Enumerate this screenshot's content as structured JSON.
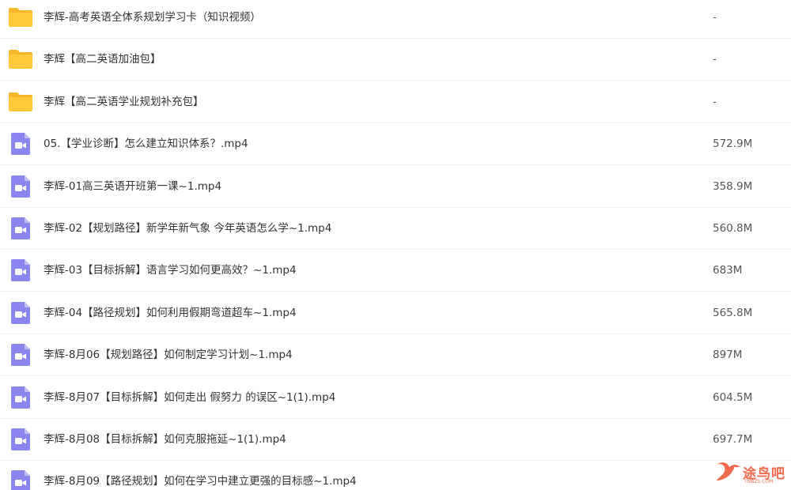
{
  "colors": {
    "folder": "#ffc93c",
    "folder_tab": "#f6b72a",
    "video": "#8b85f0",
    "watermark": "#f06a4b"
  },
  "files": [
    {
      "name": "李辉-高考英语全体系规划学习卡（知识视频）",
      "size": "-",
      "type": "folder",
      "icon": "folder-icon"
    },
    {
      "name": "李辉【高二英语加油包】",
      "size": "-",
      "type": "folder",
      "icon": "folder-icon"
    },
    {
      "name": "李辉【高二英语学业规划补充包】",
      "size": "-",
      "type": "folder",
      "icon": "folder-icon"
    },
    {
      "name": "05.【学业诊断】怎么建立知识体系？.mp4",
      "size": "572.9M",
      "type": "video",
      "icon": "video-file-icon"
    },
    {
      "name": "李辉-01高三英语开班第一课~1.mp4",
      "size": "358.9M",
      "type": "video",
      "icon": "video-file-icon"
    },
    {
      "name": "李辉-02【规划路径】新学年新气象 今年英语怎么学~1.mp4",
      "size": "560.8M",
      "type": "video",
      "icon": "video-file-icon"
    },
    {
      "name": "李辉-03【目标拆解】语言学习如何更高效？~1.mp4",
      "size": "683M",
      "type": "video",
      "icon": "video-file-icon"
    },
    {
      "name": "李辉-04【路径规划】如何利用假期弯道超车~1.mp4",
      "size": "565.8M",
      "type": "video",
      "icon": "video-file-icon"
    },
    {
      "name": "李辉-8月06【规划路径】如何制定学习计划~1.mp4",
      "size": "897M",
      "type": "video",
      "icon": "video-file-icon"
    },
    {
      "name": "李辉-8月07【目标拆解】如何走出 假努力 的误区~1(1).mp4",
      "size": "604.5M",
      "type": "video",
      "icon": "video-file-icon"
    },
    {
      "name": "李辉-8月08【目标拆解】如何克服拖延~1(1).mp4",
      "size": "697.7M",
      "type": "video",
      "icon": "video-file-icon"
    },
    {
      "name": "李辉-8月09【路径规划】如何在学习中建立更强的目标感~1.mp4",
      "size": "",
      "type": "video",
      "icon": "video-file-icon"
    }
  ],
  "watermark": {
    "text": "途鸟吧",
    "sub": "TNBZS.COM"
  }
}
